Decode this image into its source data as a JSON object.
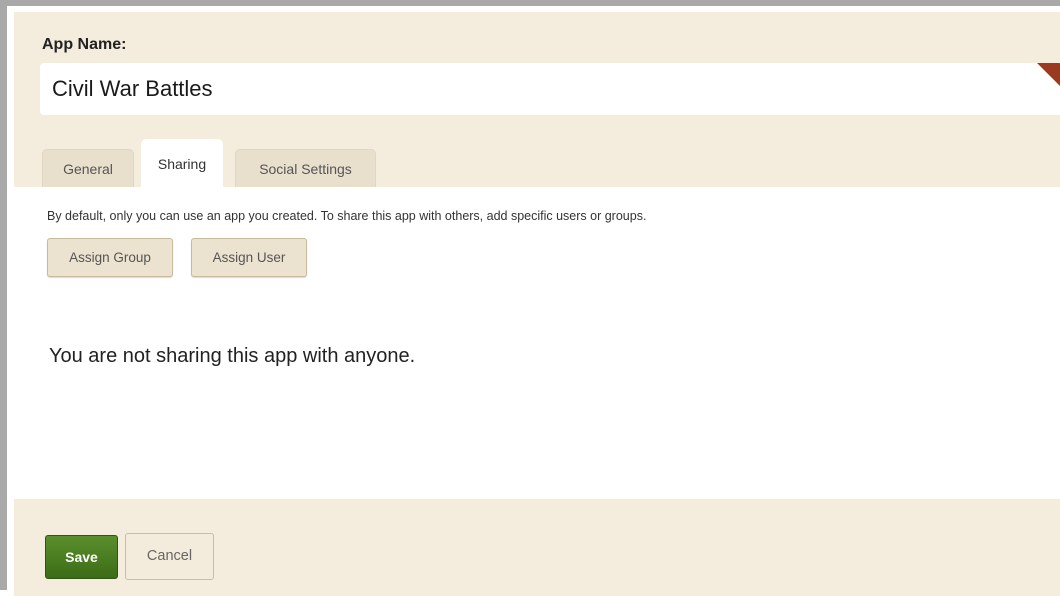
{
  "app_name": {
    "label": "App Name:",
    "value": "Civil War Battles"
  },
  "tabs": [
    {
      "label": "General",
      "active": false
    },
    {
      "label": "Sharing",
      "active": true
    },
    {
      "label": "Social Settings",
      "active": false
    }
  ],
  "sharing": {
    "description": "By default, only you can use an app you created. To share this app with others, add specific users or groups.",
    "assign_group_label": "Assign Group",
    "assign_user_label": "Assign User",
    "empty_message": "You are not sharing this app with anyone."
  },
  "footer": {
    "save_label": "Save",
    "cancel_label": "Cancel"
  },
  "colors": {
    "header_bg": "#f4ecdd",
    "save_green": "#4a7d22",
    "corner_flag": "#9b3a1e"
  }
}
